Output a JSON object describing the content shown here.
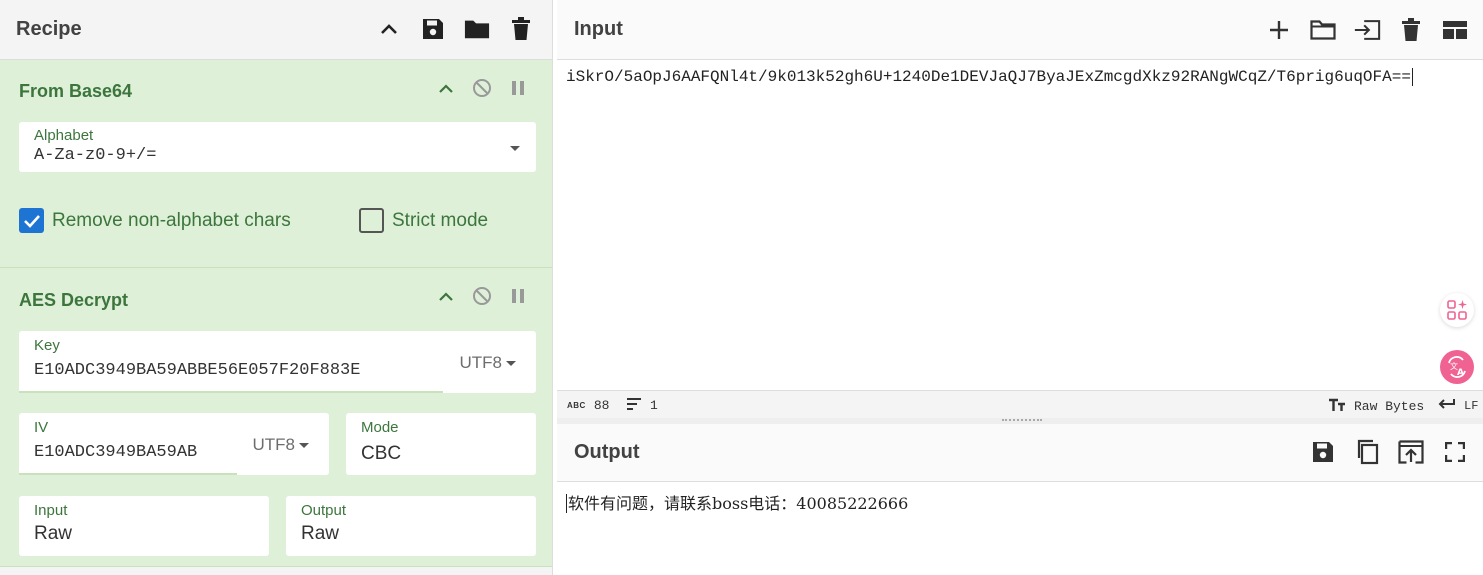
{
  "recipe": {
    "title": "Recipe",
    "operations": [
      {
        "name": "From Base64",
        "alphabet_label": "Alphabet",
        "alphabet_value": "A-Za-z0-9+/=",
        "remove_non_alphabet_label": "Remove non-alphabet chars",
        "remove_non_alphabet_checked": true,
        "strict_mode_label": "Strict mode",
        "strict_mode_checked": false
      },
      {
        "name": "AES Decrypt",
        "key_label": "Key",
        "key_value": "E10ADC3949BA59ABBE56E057F20F883E",
        "key_encoding": "UTF8",
        "iv_label": "IV",
        "iv_value": "E10ADC3949BA59AB",
        "iv_encoding": "UTF8",
        "mode_label": "Mode",
        "mode_value": "CBC",
        "input_label": "Input",
        "input_value": "Raw",
        "output_label": "Output",
        "output_value": "Raw"
      }
    ]
  },
  "input": {
    "title": "Input",
    "text": "iSkrO/5aOpJ6AAFQNl4t/9k013k52gh6U+1240De1DEVJaQJ7ByaJExZmcgdXkz92RANgWCqZ/T6prig6uqOFA==",
    "status": {
      "abc_icon_text": "ABC",
      "length": "88",
      "lines": "1",
      "raw_bytes": "Raw Bytes",
      "eol": "LF"
    }
  },
  "output": {
    "title": "Output",
    "text": "软件有问题，请联系boss电话：40085222666"
  },
  "colors": {
    "op_bg": "#dff0d8",
    "op_title": "#3c763d",
    "checkbox_on": "#1e74d2",
    "fab_accent": "#f06292"
  }
}
